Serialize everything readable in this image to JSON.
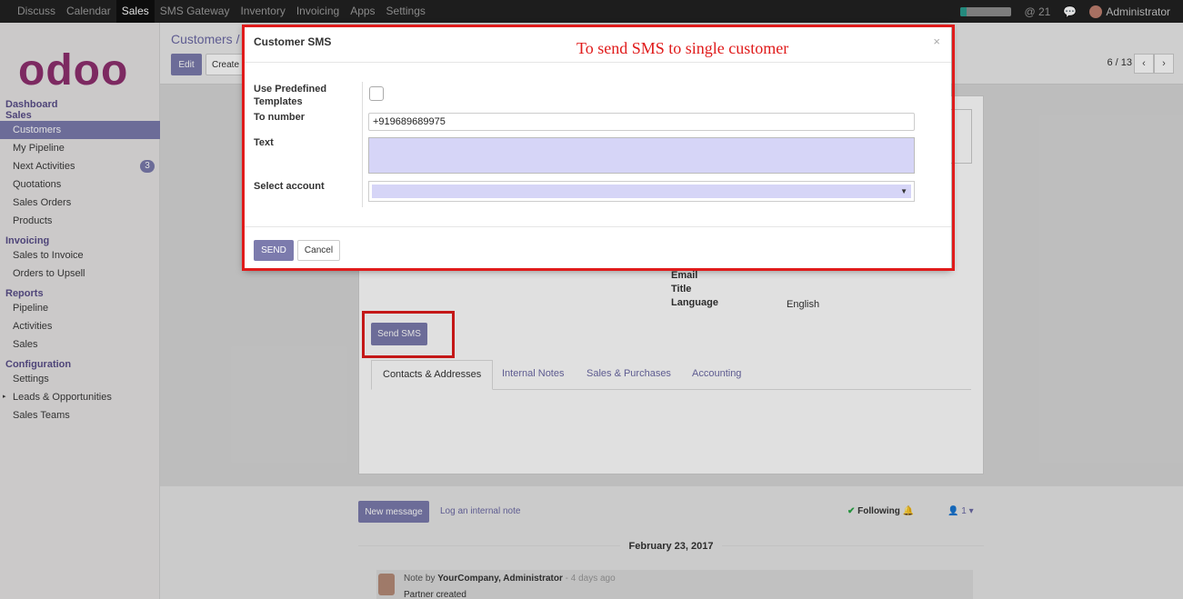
{
  "topbar": {
    "nav": [
      "Discuss",
      "Calendar",
      "Sales",
      "SMS Gateway",
      "Inventory",
      "Invoicing",
      "Apps",
      "Settings"
    ],
    "active": "Sales",
    "mentions": "@ 21",
    "user": "Administrator"
  },
  "sidebar": {
    "logo": "odoo",
    "sections": [
      {
        "title": "Dashboard",
        "items": []
      },
      {
        "title": "Sales",
        "items": [
          "Customers",
          "My Pipeline",
          "Next Activities",
          "Quotations",
          "Sales Orders",
          "Products"
        ]
      },
      {
        "title": "Invoicing",
        "items": [
          "Sales to Invoice",
          "Orders to Upsell"
        ]
      },
      {
        "title": "Reports",
        "items": [
          "Pipeline",
          "Activities",
          "Sales"
        ]
      },
      {
        "title": "Configuration",
        "items": [
          "Settings",
          "Leads & Opportunities",
          "Sales Teams"
        ]
      }
    ],
    "active_item": "Customers",
    "next_activities_badge": "3"
  },
  "control": {
    "breadcrumb": "Customers /",
    "edit": "Edit",
    "create": "Create",
    "pager": "6 / 13",
    "prev": "‹",
    "next": "›"
  },
  "sheet": {
    "labels": [
      "Email",
      "Title",
      "Language"
    ],
    "language_value": "English",
    "send_sms": "Send SMS",
    "tabs": [
      "Contacts & Addresses",
      "Internal Notes",
      "Sales & Purchases",
      "Accounting"
    ]
  },
  "chatter": {
    "new_message": "New message",
    "log_note": "Log an internal note",
    "following": "Following",
    "followers": "1",
    "date": "February 23, 2017",
    "msg_head_pre": "Note by ",
    "msg_author": "YourCompany, Administrator",
    "msg_time": " - 4 days ago",
    "msg_body": "Partner created"
  },
  "modal": {
    "title": "Customer SMS",
    "annotation": "To send SMS to single customer",
    "close": "×",
    "use_templates_label": "Use Predefined Templates",
    "to_number_label": "To number",
    "to_number_value": "+919689689975",
    "text_label": "Text",
    "account_label": "Select account",
    "send": "SEND",
    "cancel": "Cancel"
  }
}
